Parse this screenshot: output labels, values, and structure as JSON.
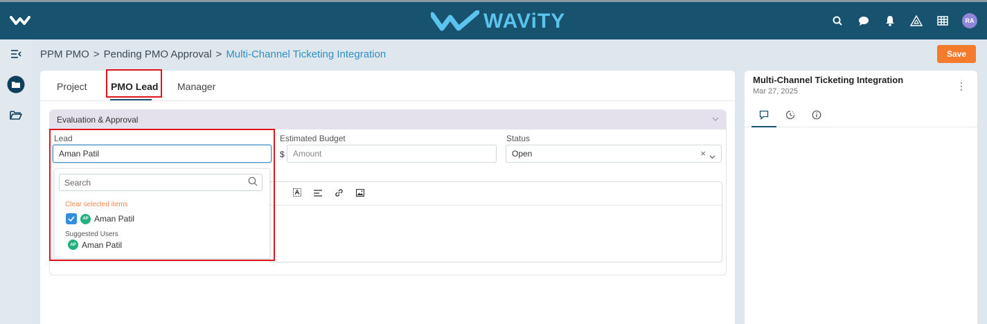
{
  "brand": {
    "name": "WAViTY"
  },
  "breadcrumb": {
    "items": [
      "PPM PMO",
      "Pending PMO Approval"
    ],
    "separator": ">",
    "current": "Multi-Channel Ticketing Integration"
  },
  "toolbar": {
    "save_label": "Save"
  },
  "user": {
    "initials": "RA"
  },
  "tabs": [
    "Project",
    "PMO Lead",
    "Manager"
  ],
  "section": {
    "title": "Evaluation & Approval"
  },
  "fields": {
    "lead": {
      "label": "Lead",
      "value": "Aman Patil"
    },
    "budget": {
      "label": "Estimated Budget",
      "currency": "$",
      "placeholder": "Amount"
    },
    "status": {
      "label": "Status",
      "value": "Open",
      "clear": "×"
    }
  },
  "dropdown": {
    "search_placeholder": "Search",
    "clear_label": "Clear selected items",
    "selected": {
      "initials": "AP",
      "name": "Aman Patil"
    },
    "suggested_label": "Suggested Users",
    "suggested": {
      "initials": "AP",
      "name": "Aman Patil"
    }
  },
  "right_panel": {
    "title": "Multi-Channel Ticketing Integration",
    "date": "Mar 27, 2025",
    "more": "⋮"
  },
  "colors": {
    "topbar": "#17526e",
    "accent": "#f47b2b",
    "highlight": "#e0141b",
    "brand_text": "#5cc3ec"
  },
  "icons": [
    "menu-logo-icon",
    "search-icon",
    "chat-icon",
    "bell-icon",
    "triangle-icon",
    "grid-icon",
    "collapse-icon",
    "folder-filled-icon",
    "folder-open-icon",
    "comment-icon",
    "history-icon",
    "info-icon",
    "chevron-down-icon"
  ]
}
